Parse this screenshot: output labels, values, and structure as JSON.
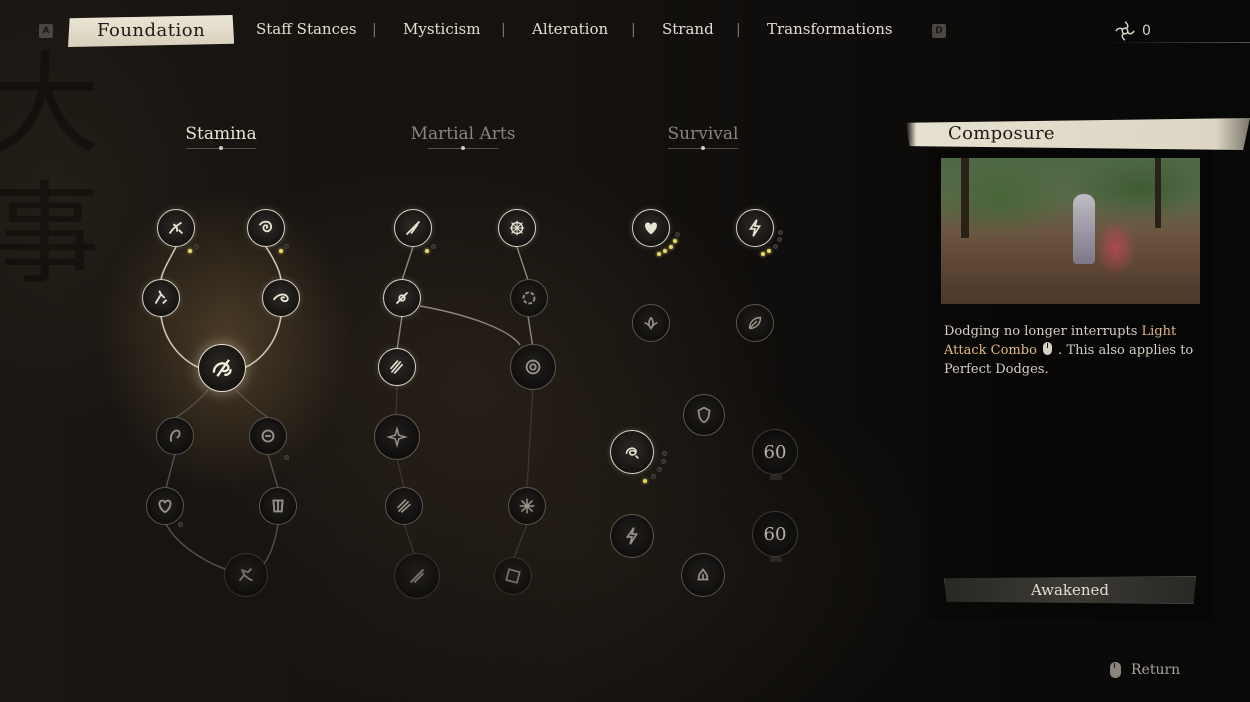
{
  "nav": {
    "left_key": "A",
    "right_key": "D",
    "tabs": [
      {
        "label": "Foundation",
        "active": true
      },
      {
        "label": "Staff Stances",
        "active": false
      },
      {
        "label": "Mysticism",
        "active": false
      },
      {
        "label": "Alteration",
        "active": false
      },
      {
        "label": "Strand",
        "active": false
      },
      {
        "label": "Transformations",
        "active": false
      }
    ],
    "separator": "|",
    "currency_value": "0"
  },
  "columns": [
    {
      "label": "Stamina",
      "active": true
    },
    {
      "label": "Martial Arts",
      "active": false
    },
    {
      "label": "Survival",
      "active": false
    }
  ],
  "locks": {
    "a": "60",
    "b": "60"
  },
  "detail": {
    "title": "Composure",
    "desc_part1": "Dodging no longer interrupts ",
    "desc_highlight": "Light Attack Combo",
    "desc_part2": " . This also applies to Perfect Dodges.",
    "status_button": "Awakened"
  },
  "footer": {
    "return_label": "Return"
  },
  "colors": {
    "accent_text": "#e2b882",
    "pip_active": "#e8d86a",
    "tab_active_bg": "#ece6d6"
  }
}
